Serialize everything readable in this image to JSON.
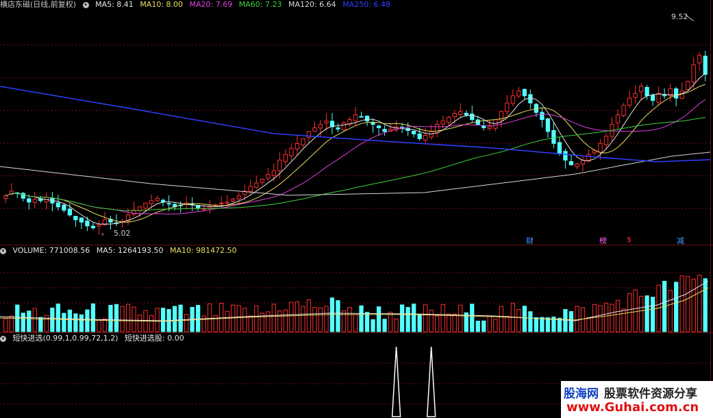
{
  "price": {
    "title": "横店东磁(日线,前复权)",
    "ma": [
      {
        "text": "MA5: 8.41"
      },
      {
        "text": "MA10: 8.00"
      },
      {
        "text": "MA20: 7.69"
      },
      {
        "text": "MA60: 7.23"
      },
      {
        "text": "MA120: 6.64"
      },
      {
        "text": "MA250: 6.48"
      }
    ],
    "high_label": "9.52",
    "low_label": "5.02"
  },
  "volume": {
    "v": {
      "text": "VOLUME: 771008.56"
    },
    "ma5": {
      "text": "MA5: 1264193.50"
    },
    "ma10": {
      "text": "MA10: 981472.50"
    }
  },
  "indicator": {
    "name": "短快进选(0.99,1,0.99,72,1,2)",
    "value_text": "短快进选股: 0.00"
  },
  "events": [
    "财",
    "榜",
    "$",
    "减"
  ],
  "colors": {
    "up": "#ff3030",
    "down": "#54ffff",
    "grid": "#6e1010"
  },
  "chart_data": {
    "type": "candlestick",
    "price_range": [
      4.9,
      9.7
    ],
    "high": 9.52,
    "low": 5.02,
    "closes": [
      5.85,
      5.95,
      5.9,
      5.8,
      5.72,
      5.78,
      5.75,
      5.82,
      5.7,
      5.62,
      5.55,
      5.45,
      5.35,
      5.3,
      5.22,
      5.18,
      5.25,
      5.35,
      5.3,
      5.28,
      5.32,
      5.45,
      5.55,
      5.62,
      5.7,
      5.75,
      5.8,
      5.72,
      5.68,
      5.62,
      5.65,
      5.7,
      5.66,
      5.6,
      5.58,
      5.62,
      5.66,
      5.7,
      5.72,
      5.78,
      5.85,
      5.95,
      6.05,
      6.12,
      6.2,
      6.3,
      6.38,
      6.6,
      6.72,
      6.85,
      6.95,
      7.05,
      7.2,
      7.28,
      7.35,
      7.42,
      7.3,
      7.25,
      7.38,
      7.45,
      7.55,
      7.5,
      7.42,
      7.35,
      7.28,
      7.2,
      7.25,
      7.3,
      7.28,
      7.22,
      7.15,
      7.05,
      7.12,
      7.2,
      7.35,
      7.42,
      7.5,
      7.58,
      7.62,
      7.55,
      7.45,
      7.35,
      7.28,
      7.3,
      7.45,
      7.62,
      7.8,
      7.95,
      8.05,
      7.95,
      7.8,
      7.6,
      7.45,
      7.2,
      6.95,
      6.75,
      6.6,
      6.5,
      6.52,
      6.6,
      6.72,
      6.8,
      6.95,
      7.1,
      7.35,
      7.55,
      7.75,
      7.9,
      8.0,
      8.15,
      7.95,
      7.85,
      8.0,
      7.95,
      8.1,
      7.9,
      8.05,
      8.25,
      8.6,
      8.8,
      8.4
    ],
    "volume_range": [
      0,
      2600000
    ],
    "indicator_signals": [
      67,
      73,
      127,
      148,
      169,
      234
    ]
  },
  "watermark": {
    "brand": "股海网",
    "slogan": "股票软件资源分享",
    "url": "www.Guhai.com.cn"
  }
}
